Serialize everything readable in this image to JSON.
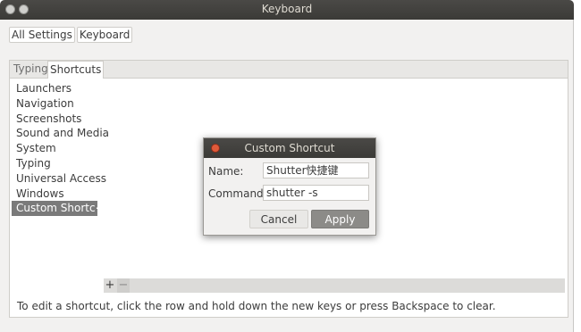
{
  "window": {
    "title": "Keyboard"
  },
  "breadcrumb": {
    "all_settings": "All Settings",
    "current": "Keyboard"
  },
  "tabs": [
    {
      "label": "Typing"
    },
    {
      "label": "Shortcuts"
    }
  ],
  "categories": [
    {
      "label": "Launchers"
    },
    {
      "label": "Navigation"
    },
    {
      "label": "Screenshots"
    },
    {
      "label": "Sound and Media"
    },
    {
      "label": "System"
    },
    {
      "label": "Typing"
    },
    {
      "label": "Universal Access"
    },
    {
      "label": "Windows"
    },
    {
      "label": "Custom Shortc⋯"
    }
  ],
  "toolbar": {
    "add": "+",
    "remove": "−"
  },
  "help_text": "To edit a shortcut, click the row and hold down the new keys or press Backspace to clear.",
  "dialog": {
    "title": "Custom Shortcut",
    "name_label": "Name:",
    "name_value": "Shutter快捷键",
    "command_label": "Command:",
    "command_value": "shutter -s",
    "cancel_label": "Cancel",
    "apply_label": "Apply"
  }
}
